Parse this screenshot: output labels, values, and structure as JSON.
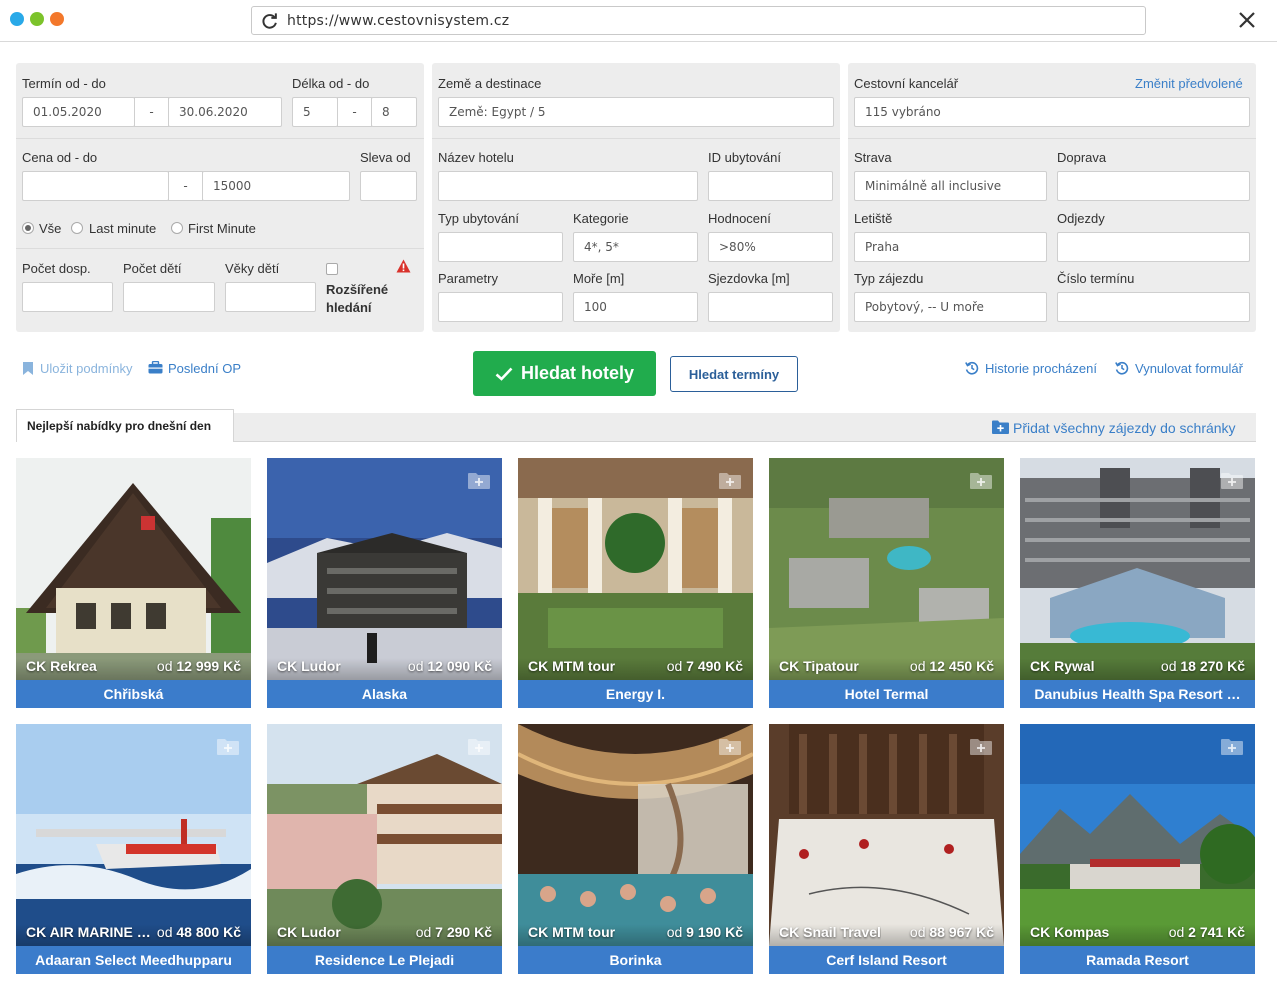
{
  "browser": {
    "url": "https://www.cestovnisystem.cz",
    "dots": [
      "#29a9e8",
      "#7cc32b",
      "#f3782b"
    ]
  },
  "search": {
    "term_label": "Termín od - do",
    "date_from": "01.05.2020",
    "date_sep": "-",
    "date_to": "30.06.2020",
    "length_label": "Délka od - do",
    "length_from": "5",
    "length_sep": "-",
    "length_to": "8",
    "price_label": "Cena od - do",
    "price_from": "",
    "price_sep": "-",
    "price_to": "15000",
    "discount_label": "Sleva od",
    "discount": "",
    "radio_all": "Vše",
    "radio_last": "Last minute",
    "radio_first": "First Minute",
    "adults_label": "Počet dosp.",
    "children_label": "Počet dětí",
    "ages_label": "Věky dětí",
    "advanced_line1": "Rozšířené",
    "advanced_line2": "hledání",
    "country_label": "Země a destinace",
    "country_value": "Země: Egypt / 5",
    "hotel_label": "Název hotelu",
    "accom_id_label": "ID ubytování",
    "accom_type_label": "Typ ubytování",
    "category_label": "Kategorie",
    "category_value": "4*, 5*",
    "rating_label": "Hodnocení",
    "rating_value": ">80%",
    "params_label": "Parametry",
    "sea_label": "Moře [m]",
    "sea_value": "100",
    "slope_label": "Sjezdovka [m]",
    "agency_label": "Cestovní kancelář",
    "agency_change": "Změnit předvolené",
    "agency_value": "115 vybráno",
    "board_label": "Strava",
    "board_value": "Minimálně all inclusive",
    "transport_label": "Doprava",
    "airport_label": "Letiště",
    "airport_value": "Praha",
    "departures_label": "Odjezdy",
    "trip_type_label": "Typ zájezdu",
    "trip_type_value": "Pobytový, -- U moře",
    "term_number_label": "Číslo termínu"
  },
  "actions": {
    "save_conditions": "Uložit podmínky",
    "last_op": "Poslední OP",
    "search_hotels": "Hledat hotely",
    "search_terms": "Hledat termíny",
    "history": "Historie procházení",
    "reset": "Vynulovat formulář"
  },
  "offers": {
    "tab": "Nejlepší nabídky pro dnešní den",
    "add_all": "Přidat všechny zájezdy do schránky",
    "cards": [
      {
        "agency": "CK Rekrea",
        "price_prefix": "od",
        "price": "12 999 Kč",
        "name": "Chřibská"
      },
      {
        "agency": "CK Ludor",
        "price_prefix": "od",
        "price": "12 090 Kč",
        "name": "Alaska"
      },
      {
        "agency": "CK MTM tour",
        "price_prefix": "od",
        "price": "7 490 Kč",
        "name": "Energy I."
      },
      {
        "agency": "CK Tipatour",
        "price_prefix": "od",
        "price": "12 450 Kč",
        "name": "Hotel Termal"
      },
      {
        "agency": "CK Rywal",
        "price_prefix": "od",
        "price": "18 270 Kč",
        "name": "Danubius Health Spa Resort …"
      },
      {
        "agency": "CK AIR MARINE …",
        "price_prefix": "od",
        "price": "48 800 Kč",
        "name": "Adaaran Select Meedhupparu"
      },
      {
        "agency": "CK Ludor",
        "price_prefix": "od",
        "price": "7 290 Kč",
        "name": "Residence Le Plejadi"
      },
      {
        "agency": "CK MTM tour",
        "price_prefix": "od",
        "price": "9 190 Kč",
        "name": "Borinka"
      },
      {
        "agency": "CK Snail Travel",
        "price_prefix": "od",
        "price": "88 967 Kč",
        "name": "Cerf Island Resort"
      },
      {
        "agency": "CK Kompas",
        "price_prefix": "od",
        "price": "2 741 Kč",
        "name": "Ramada Resort"
      }
    ]
  }
}
